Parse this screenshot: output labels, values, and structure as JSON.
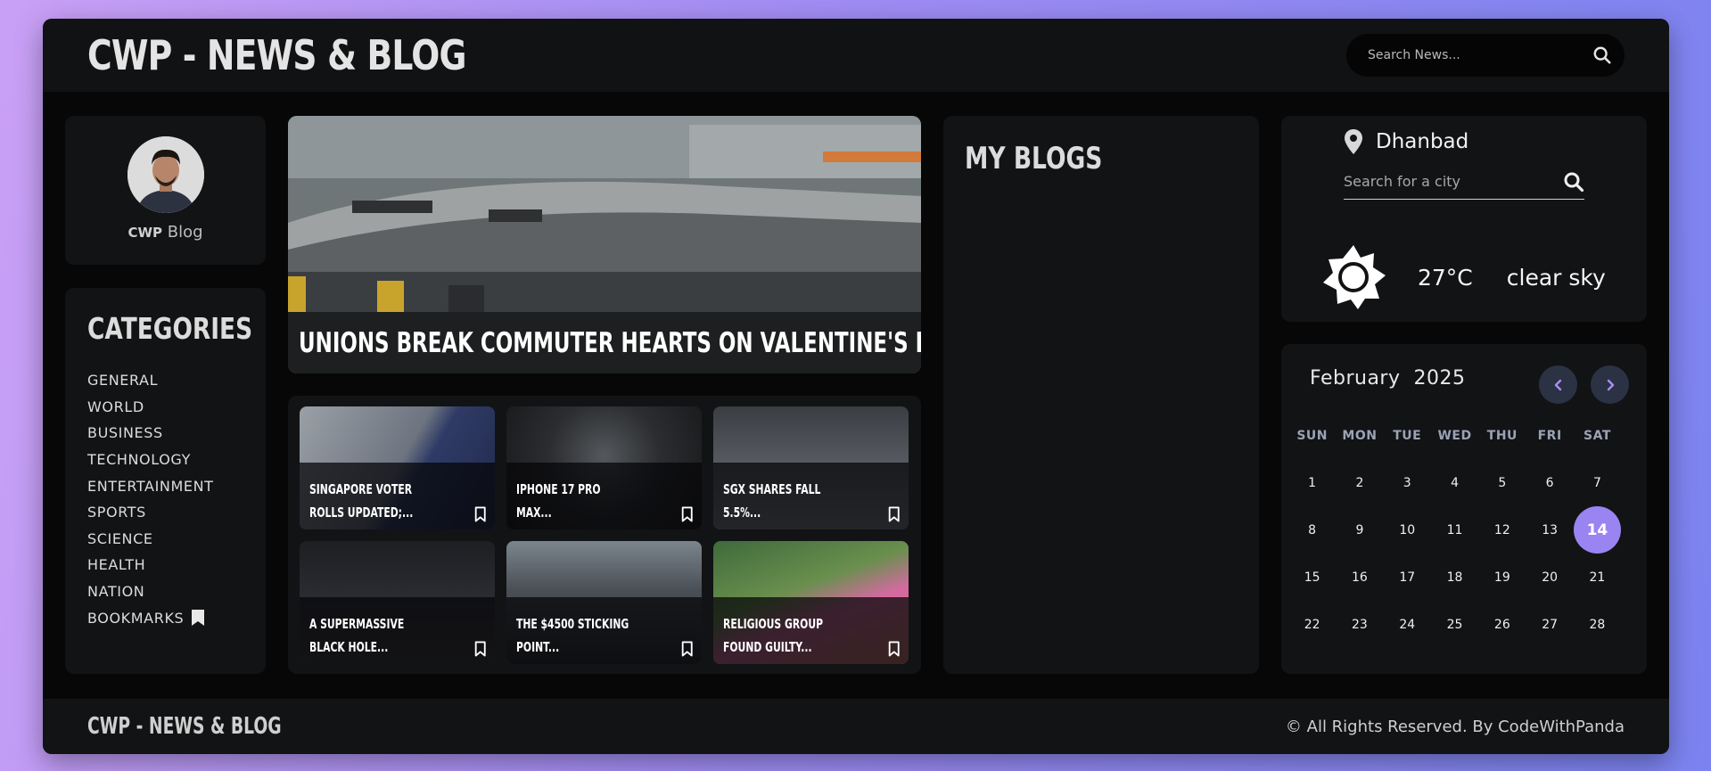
{
  "header": {
    "brand": "CWP - NEWS & BLOG",
    "search_placeholder": "Search News..."
  },
  "profile": {
    "label_bold": "CWP",
    "label_rest": " Blog"
  },
  "categories": {
    "title": "CATEGORIES",
    "items": [
      "GENERAL",
      "WORLD",
      "BUSINESS",
      "TECHNOLOGY",
      "ENTERTAINMENT",
      "SPORTS",
      "SCIENCE",
      "HEALTH",
      "NATION",
      "BOOKMARKS"
    ]
  },
  "headline": {
    "title": "UNIONS BREAK COMMUTER HEARTS ON VALENTINE'S DAY"
  },
  "news": [
    {
      "title": "SINGAPORE VOTER ROLLS UPDATED;..."
    },
    {
      "title": "IPHONE 17 PRO MAX..."
    },
    {
      "title": "SGX SHARES FALL 5.5%..."
    },
    {
      "title": "A SUPERMASSIVE BLACK HOLE..."
    },
    {
      "title": "THE $4500 STICKING POINT..."
    },
    {
      "title": "RELIGIOUS GROUP FOUND GUILTY..."
    }
  ],
  "blogs": {
    "title": "MY BLOGS"
  },
  "weather": {
    "city": "Dhanbad",
    "city_placeholder": "Search for a city",
    "temp": "27°C",
    "description": "clear sky",
    "icon": "sun-icon"
  },
  "calendar": {
    "month": "February",
    "year": "2025",
    "weekdays": [
      "SUN",
      "MON",
      "TUE",
      "WED",
      "THU",
      "FRI",
      "SAT"
    ],
    "days": [
      1,
      2,
      3,
      4,
      5,
      6,
      7,
      8,
      9,
      10,
      11,
      12,
      13,
      14,
      15,
      16,
      17,
      18,
      19,
      20,
      21,
      22,
      23,
      24,
      25,
      26,
      27,
      28
    ],
    "today": 14,
    "accent": "#9a84f2"
  },
  "footer": {
    "brand": "CWP - NEWS & BLOG",
    "copyright": "© All Rights Reserved. By CodeWithPanda"
  }
}
